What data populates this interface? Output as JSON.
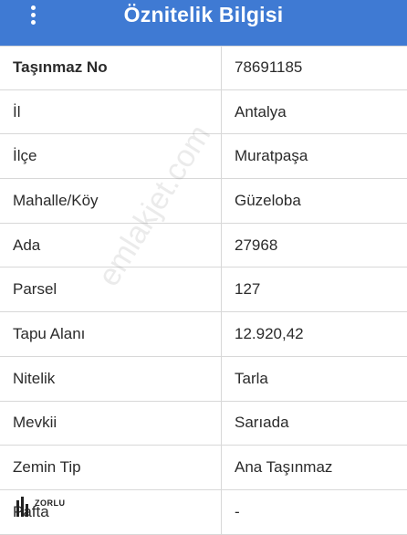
{
  "header": {
    "title": "Öznitelik Bilgisi",
    "menu_icon": "kebab-menu-icon"
  },
  "rows": [
    {
      "key": "Taşınmaz No",
      "value": "78691185"
    },
    {
      "key": "İl",
      "value": "Antalya"
    },
    {
      "key": "İlçe",
      "value": "Muratpaşa"
    },
    {
      "key": "Mahalle/Köy",
      "value": "Güzeloba"
    },
    {
      "key": "Ada",
      "value": "27968"
    },
    {
      "key": "Parsel",
      "value": "127"
    },
    {
      "key": "Tapu Alanı",
      "value": "12.920,42"
    },
    {
      "key": "Nitelik",
      "value": "Tarla"
    },
    {
      "key": "Mevkii",
      "value": "Sarıada"
    },
    {
      "key": "Zemin Tip",
      "value": "Ana Taşınmaz"
    },
    {
      "key": "Pafta",
      "value": "-"
    }
  ],
  "watermark": "emlakjet.com",
  "logo_text": "ZORLU",
  "colors": {
    "header_bg": "#3f7ad3",
    "header_text": "#ffffff",
    "grid_line": "#d8d8d8"
  }
}
